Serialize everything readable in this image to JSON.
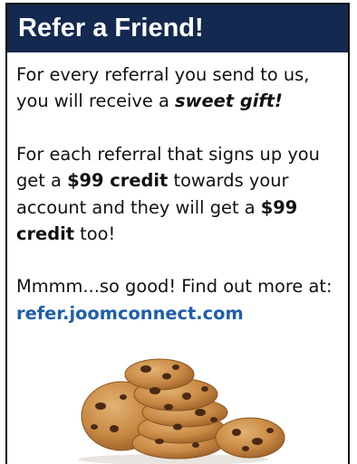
{
  "header": {
    "title": "Refer a Friend!"
  },
  "paragraph1": {
    "text_a": "For every referral you send to us, you will receive a ",
    "emphasis": "sweet gift!"
  },
  "paragraph2": {
    "text_a": "For each referral that signs up you get a ",
    "credit_1": "$99 credit",
    "text_b": " towards your account and they will get a ",
    "credit_2": "$99 credit",
    "text_c": " too!"
  },
  "paragraph3": {
    "text_a": "Mmmm...so good! Find out more at: ",
    "link": "refer.joomconnect.com"
  },
  "image": {
    "icon": "cookies-image",
    "colors": {
      "border": "#111111",
      "header_bg": "#14294f",
      "link": "#1f5fa8",
      "cookie": "#c98a45",
      "chip": "#4a2a14"
    }
  }
}
